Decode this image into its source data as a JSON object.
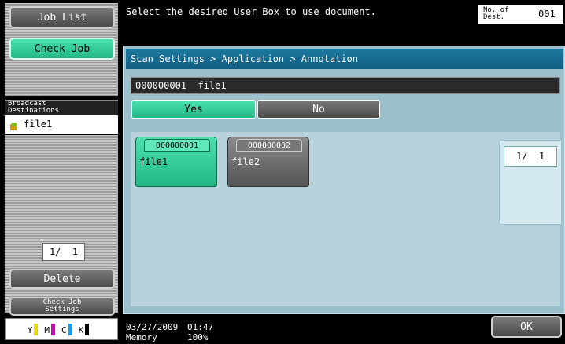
{
  "sidebar": {
    "job_list": "Job List",
    "check_job": "Check Job",
    "broadcast_header": "Broadcast\nDestinations",
    "dest_item": "file1",
    "page_indicator": "1/  1",
    "delete": "Delete",
    "check_job_settings": "Check Job\nSettings"
  },
  "toner": [
    {
      "label": "Y",
      "color": "#e6d900"
    },
    {
      "label": "M",
      "color": "#d800b8"
    },
    {
      "label": "C",
      "color": "#14a0f0"
    },
    {
      "label": "K",
      "color": "#000000"
    }
  ],
  "header": {
    "message": "Select the desired User Box to use document.",
    "dest_label": "No. of\nDest.",
    "dest_count": "001"
  },
  "panel": {
    "breadcrumb": "Scan Settings > Application > Annotation",
    "selected_box": "000000001  file1",
    "yes": "Yes",
    "no": "No",
    "boxes": [
      {
        "number": "000000001",
        "name": "file1",
        "selected": true
      },
      {
        "number": "000000002",
        "name": "file2",
        "selected": false
      }
    ],
    "page_indicator": "1/  1"
  },
  "footer": {
    "date": "03/27/2009",
    "time": "01:47",
    "memory_label": "Memory",
    "memory_value": "100%",
    "ok": "OK"
  }
}
